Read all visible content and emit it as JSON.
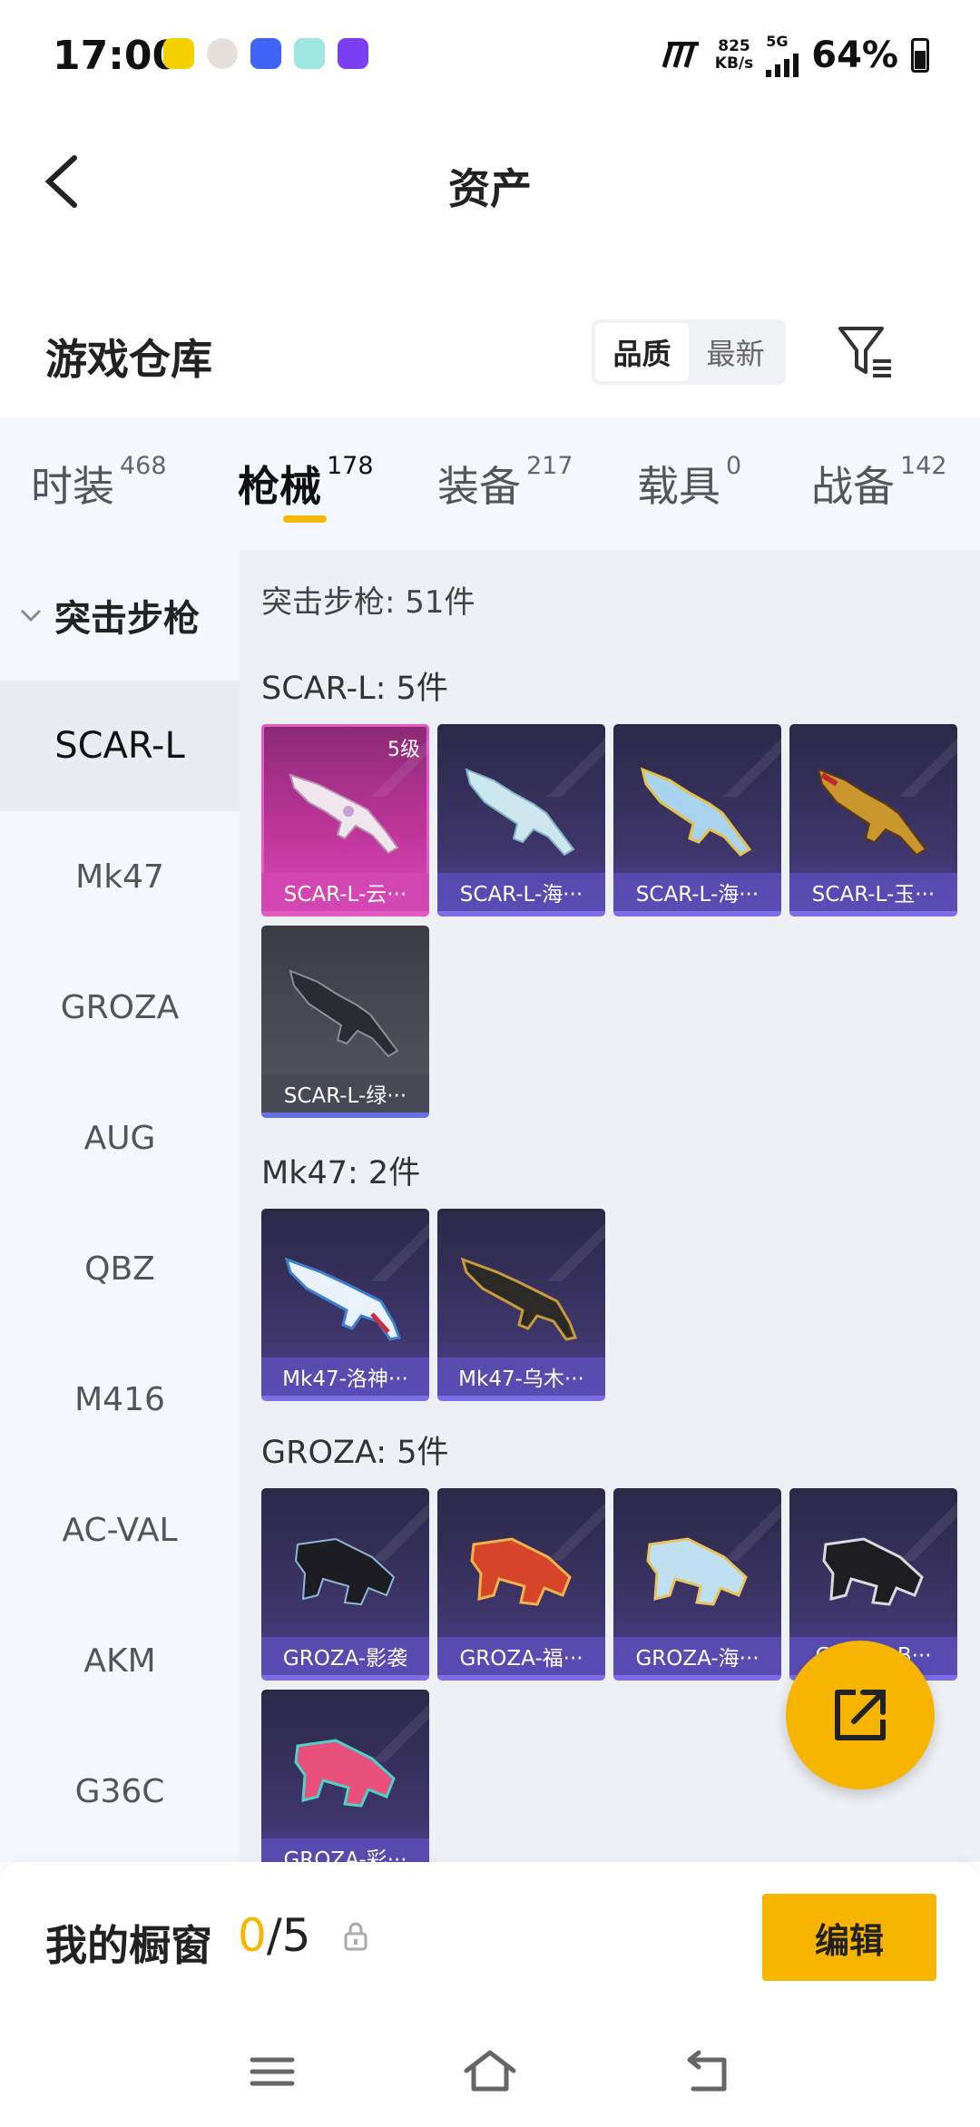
{
  "status_bar": {
    "time": "17:00",
    "app_icon_colors": [
      "#f5d100",
      "#e8e0d8",
      "#3f63f4",
      "#9ee6df",
      "#7b3ff2"
    ],
    "speed_value": "825",
    "speed_unit": "KB/s",
    "network": "5G",
    "battery": "64%"
  },
  "header": {
    "title": "资产"
  },
  "warehouse": {
    "title": "游戏仓库",
    "sort_options": [
      "品质",
      "最新"
    ]
  },
  "tabs": [
    {
      "label": "时装",
      "count": "468"
    },
    {
      "label": "枪械",
      "count": "178"
    },
    {
      "label": "装备",
      "count": "217"
    },
    {
      "label": "载具",
      "count": "0"
    },
    {
      "label": "战备",
      "count": "142"
    }
  ],
  "sidebar": {
    "group": "突击步枪",
    "items": [
      "SCAR-L",
      "Mk47",
      "GROZA",
      "AUG",
      "QBZ",
      "M416",
      "AC-VAL",
      "AKM",
      "G36C"
    ]
  },
  "main": {
    "header": "突击步枪: 51件",
    "sections": [
      {
        "title": "SCAR-L: 5件",
        "items": [
          {
            "name": "SCAR-L-云···",
            "level": "5级"
          },
          {
            "name": "SCAR-L-海···"
          },
          {
            "name": "SCAR-L-海···"
          },
          {
            "name": "SCAR-L-玉···"
          },
          {
            "name": "SCAR-L-绿···"
          }
        ]
      },
      {
        "title": "Mk47: 2件",
        "items": [
          {
            "name": "Mk47-洛神···"
          },
          {
            "name": "Mk47-乌木···"
          }
        ]
      },
      {
        "title": "GROZA: 5件",
        "items": [
          {
            "name": "GROZA-影袭"
          },
          {
            "name": "GROZA-福···"
          },
          {
            "name": "GROZA-海···"
          },
          {
            "name": "GROZA-B···"
          },
          {
            "name": "GROZA-彩···"
          }
        ]
      }
    ]
  },
  "showcase": {
    "label": "我的橱窗",
    "current": "0",
    "total": "/5",
    "edit_label": "编辑"
  },
  "colors": {
    "accent": "#f7b500",
    "tab_indicator": "#f5b800"
  }
}
